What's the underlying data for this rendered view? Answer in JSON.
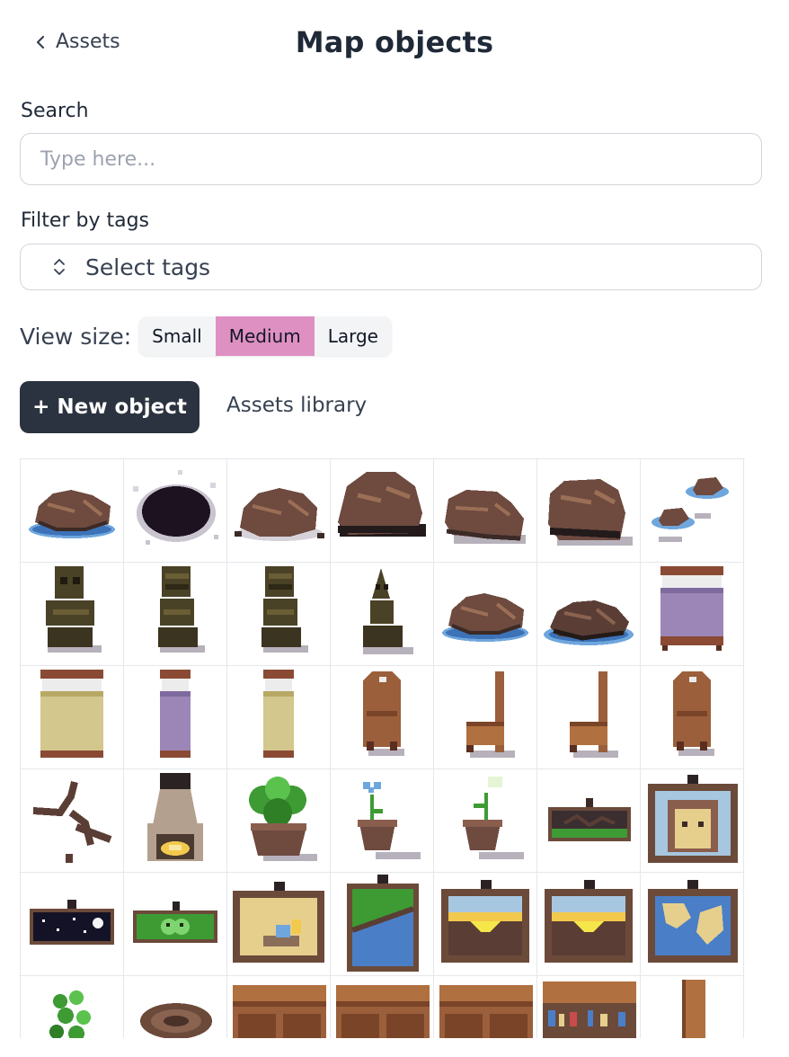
{
  "header": {
    "back_label": "Assets",
    "title": "Map objects"
  },
  "search": {
    "label": "Search",
    "placeholder": "Type here..."
  },
  "filter": {
    "label": "Filter by tags",
    "select_text": "Select tags"
  },
  "view_size": {
    "label": "View size:",
    "options": [
      "Small",
      "Medium",
      "Large"
    ],
    "selected": "Medium"
  },
  "actions": {
    "new_object": "+ New object",
    "assets_library": "Assets library"
  },
  "grid": {
    "columns": 7,
    "items": [
      "rock-in-water-icon",
      "dark-hole-icon",
      "rubble-rock-icon",
      "dark-boulder-icon",
      "flat-rock-icon",
      "round-boulder-icon",
      "pebbles-in-water-icon",
      "stone-statue-icon",
      "stone-statue-side-icon",
      "stone-statue-side-icon",
      "stone-idol-icon",
      "rock-in-water-icon",
      "dark-rock-in-water-icon",
      "double-bed-purple-icon",
      "double-bed-yellow-icon",
      "single-bed-purple-icon",
      "single-bed-yellow-icon",
      "chair-back-icon",
      "chair-side-icon",
      "chair-side-icon",
      "chair-back-icon",
      "crack-icon",
      "fireplace-icon",
      "potted-bush-icon",
      "potted-flower-blue-icon",
      "potted-flower-white-icon",
      "landscape-sign-icon",
      "portrait-frame-icon",
      "night-sky-sign-icon",
      "frog-sign-icon",
      "still-life-frame-icon",
      "hillside-frame-icon",
      "sunset-frame-icon",
      "sunset-frame-icon",
      "map-frame-icon",
      "vine-plant-icon",
      "round-rug-icon",
      "cabinet-icon",
      "cabinet-icon",
      "cabinet-icon",
      "bookshelf-icon",
      "wooden-post-icon"
    ]
  },
  "colors": {
    "accent": "#df90c3",
    "primary_button": "#2b3340",
    "rock": "#6e4a3f",
    "water": "#6fa6dd",
    "wood": "#9b5f3b",
    "bed_purple": "#9c86b8",
    "bed_yellow": "#d4c78d",
    "statue": "#4a4226",
    "leaf": "#3e9b34"
  }
}
